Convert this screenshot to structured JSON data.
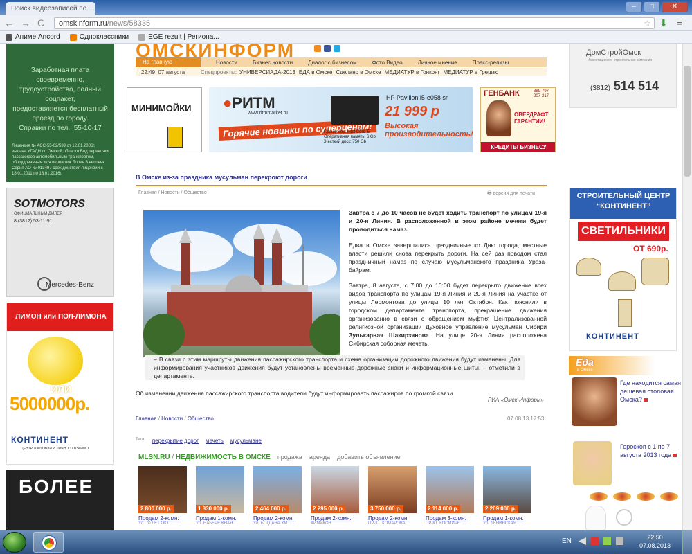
{
  "browser": {
    "tab_title": "Поиск видеозаписей по ...",
    "url_domain": "omskinform.ru",
    "url_path": "/news/58335",
    "bookmarks": [
      "Аниме Ancord",
      "Одноклассники",
      "EGE rezult | Региона..."
    ],
    "colors": {
      "frame": "#2b5fa8"
    }
  },
  "left_ads": {
    "salary": {
      "lines": [
        "Заработная плата своевременно,",
        "трудоустройство, полный соцпакет,",
        "предоставляется бесплатный проезд по городу.",
        "Справки по тел.: 55-10-17"
      ],
      "fine_print": "Лицензия № АСС-55-02/539 от 12.01.2006г. выдана УГАДН по Омской области Вид перевозки пассажиров автомобильным транспортом, оборудованным для перевозок более 8 человек. Серия АО № 013497 срок действия лицензии с 18.01.2011 по 18.01.2016г."
    },
    "sotmotors": {
      "brand": "SOTMOTORS",
      "dealer": "ОФИЦИАЛЬНЫЙ ДИЛЕР",
      "phone": "8 (3812) 53-11-91",
      "make": "Mercedes-Benz"
    },
    "lemon": {
      "title": "ЛИМОН или ПОЛ-ЛИМОНА",
      "or": "ИЛИ",
      "amount": "5000000р.",
      "logo": "КОНТИНЕНТ",
      "logo_sub": "ЦЕНТР ТОРГОВЛИ И ЛИЧНОГО ВЗАИМО"
    },
    "more": {
      "text": "БОЛЕЕ"
    }
  },
  "site": {
    "logo": "ОМСКИНФОРМ",
    "nav_home": "На главную",
    "nav": [
      "Новости",
      "Бизнес новости",
      "Диалог с бизнесом",
      "Фото Видео",
      "Личное мнение",
      "Пресс-релизы"
    ],
    "time": "22:49",
    "date": "07 августа",
    "special_label": "Спецпроекты:",
    "special": [
      "УНИВЕРСИАДА-2013",
      "ЕДА в Омске",
      "Сделано в Омске",
      "МЕДИАТУР в Гонконг",
      "МЕДИАТУР в Грецию"
    ]
  },
  "banners": {
    "minimoiki": "МИНИМОЙКИ",
    "ritm": {
      "logo": "РИТМ",
      "site": "www.ritmmarket.ru",
      "slogan": "Горячие новинки по суперценам!",
      "model": "HP Pavilion l5-e058 sr",
      "price": "21 999 р",
      "specs": [
        "Процессор: Intel Core i5",
        "Оперативная память: 6 Gb",
        "Жесткий диск: 750 Gb"
      ],
      "perf": "Высокая производительность!"
    },
    "genbank": {
      "name": "ГЕНБАНК",
      "phones": [
        "389-797",
        "207-217"
      ],
      "offer": "ОВЕРДРАФТ ГАРАНТИИ!",
      "footer": "КРЕДИТЫ БИЗНЕСУ"
    }
  },
  "article": {
    "title": "В Омске из-за праздника мусульман перекроют дороги",
    "crumbs": [
      "Главная",
      "Новости",
      "Общество"
    ],
    "print_link": "версия для печати",
    "lead": "Завтра с 7 до 10 часов не будет ходить транспорт по улицам 19-я и 20-я Линия. В расположенной в этом районе мечети будет проводиться намаз.",
    "p1": "Едва в Омске завершились праздничные ко Дню города, местные власти решили снова перекрыть дороги. На сей раз поводом стал праздничный намаз по случаю мусульманского праздника Ураза-байрам.",
    "p2_a": "Завтра, 8 августа, с 7:00 до 10:00 будет перекрыто движение всех видов транспорта по улицам 19-я Линия и 20-я Линия на участке от улицы Лермонтова до улицы 10 лет Октября. Как пояснили в городском департаменте транспорта, прекращение движения организованно в связи с обращением муфтия Централизованной религиозной организации Духовное управление мусульман Сибири",
    "p2_bold": "Зулькарная Шакирзянова",
    "p2_b": ". На улице 20-я Линия расположена Сибирская соборная мечеть.",
    "quote": "– В связи с этим маршруты движения пассажирского транспорта и схема организации дорожного движения будут изменены. Для информирования участников движения будут установлены временные дорожные знаки и информационные щиты, – отметили в департаменте.",
    "p3": "Об изменении движения пассажирского транспорта водители будут информировать пассажиров по громкой связи.",
    "source": "РИА «Омск-Информ»",
    "date": "07.08.13 17:53",
    "tags_label": "Теги:",
    "tags": [
      "перекрытие дорог",
      "мечеть",
      "мусульмане"
    ]
  },
  "mlsn": {
    "site": "MLSN.RU",
    "sep": "/",
    "heading": "НЕДВИЖИМОСТЬ В ОМСКЕ",
    "links": [
      "продажа",
      "аренда",
      "добавить объявление"
    ],
    "listings": [
      {
        "price": "2 800 000 р.",
        "title": "Продам 2-комн.",
        "addr": "УЛ. 70 ЛЕТ ОКТ..."
      },
      {
        "price": "1 830 000 р.",
        "title": "Продам 1-комн.",
        "addr": "УЛ. НАБЕРЕЖНАЯ..."
      },
      {
        "price": "2 464 000 р.",
        "title": "Продам 2-комн.",
        "addr": "УЛ. БОГДАНА ХМ..."
      },
      {
        "price": "2 295 000 р.",
        "title": "Продам 2-комн.",
        "addr": "ХИМИКОВ"
      },
      {
        "price": "3 750 000 р.",
        "title": "Продам 2-комн.",
        "addr": "ПР-КТ. КОМАРОВА"
      },
      {
        "price": "2 114 000 р.",
        "title": "Продам 3-комн.",
        "addr": "ПР-КТ. КОСМИЧЕ..."
      },
      {
        "price": "2 209 000 р.",
        "title": "Продам 1-комн.",
        "addr": "УЛ. ЛЕНИНСКАЯ..."
      }
    ]
  },
  "right_ads": {
    "domstroy": {
      "name": "ДомСтройОмск",
      "sub": "Инвестиционно-строительная компания",
      "code": "(3812)",
      "phone": "514 514"
    },
    "kontinent": {
      "header": "СТРОИТЕЛЬНЫЙ ЦЕНТР “КОНТИНЕНТ”",
      "item": "СВЕТИЛЬНИКИ",
      "price": "ОТ 690р.",
      "logo": "КОНТИНЕНТ"
    },
    "eda": {
      "title": "Еда",
      "sub": "в Омске"
    },
    "q1": "Где находится самая дешевая столовая Омска?",
    "q2": "Гороскоп с 1 по 7 августа 2013 года"
  },
  "taskbar": {
    "lang": "EN",
    "time": "22:50",
    "date": "07.08.2013"
  }
}
